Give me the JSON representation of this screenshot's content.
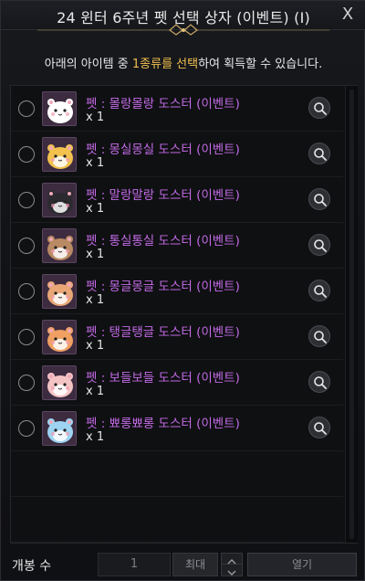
{
  "window": {
    "title": "24 윈터 6주년 펫 선택 상자 (이벤트) (I)",
    "close_label": "X"
  },
  "instruction": {
    "prefix": "아래의 아이템 중 ",
    "highlight": "1종류를 선택",
    "suffix": "하여 획득할 수 있습니다."
  },
  "items": [
    {
      "name": "펫 : 몰랑몰랑 도스터 (이벤트)",
      "qty": "x 1",
      "color": "#ffffff"
    },
    {
      "name": "펫 : 몽실몽실 도스터 (이벤트)",
      "qty": "x 1",
      "color": "#f2c14e"
    },
    {
      "name": "펫 : 말랑말랑 도스터 (이벤트)",
      "qty": "x 1",
      "color": "#2b2b2f"
    },
    {
      "name": "펫 : 통실통실 도스터 (이벤트)",
      "qty": "x 1",
      "color": "#b98a63"
    },
    {
      "name": "펫 : 몽글몽글 도스터 (이벤트)",
      "qty": "x 1",
      "color": "#e9a777"
    },
    {
      "name": "펫 : 탱글탱글 도스터 (이벤트)",
      "qty": "x 1",
      "color": "#f0a062"
    },
    {
      "name": "펫 : 보들보들 도스터 (이벤트)",
      "qty": "x 1",
      "color": "#f4c4c4"
    },
    {
      "name": "펫 : 뾰롱뾰롱 도스터 (이벤트)",
      "qty": "x 1",
      "color": "#9ed4f2"
    }
  ],
  "footer": {
    "open_count_label": "개봉 수",
    "quantity_value": "1",
    "max_label": "최대",
    "open_label": "열기"
  },
  "colors": {
    "item_name": "#c36ae6",
    "highlight": "#f2c14e"
  }
}
